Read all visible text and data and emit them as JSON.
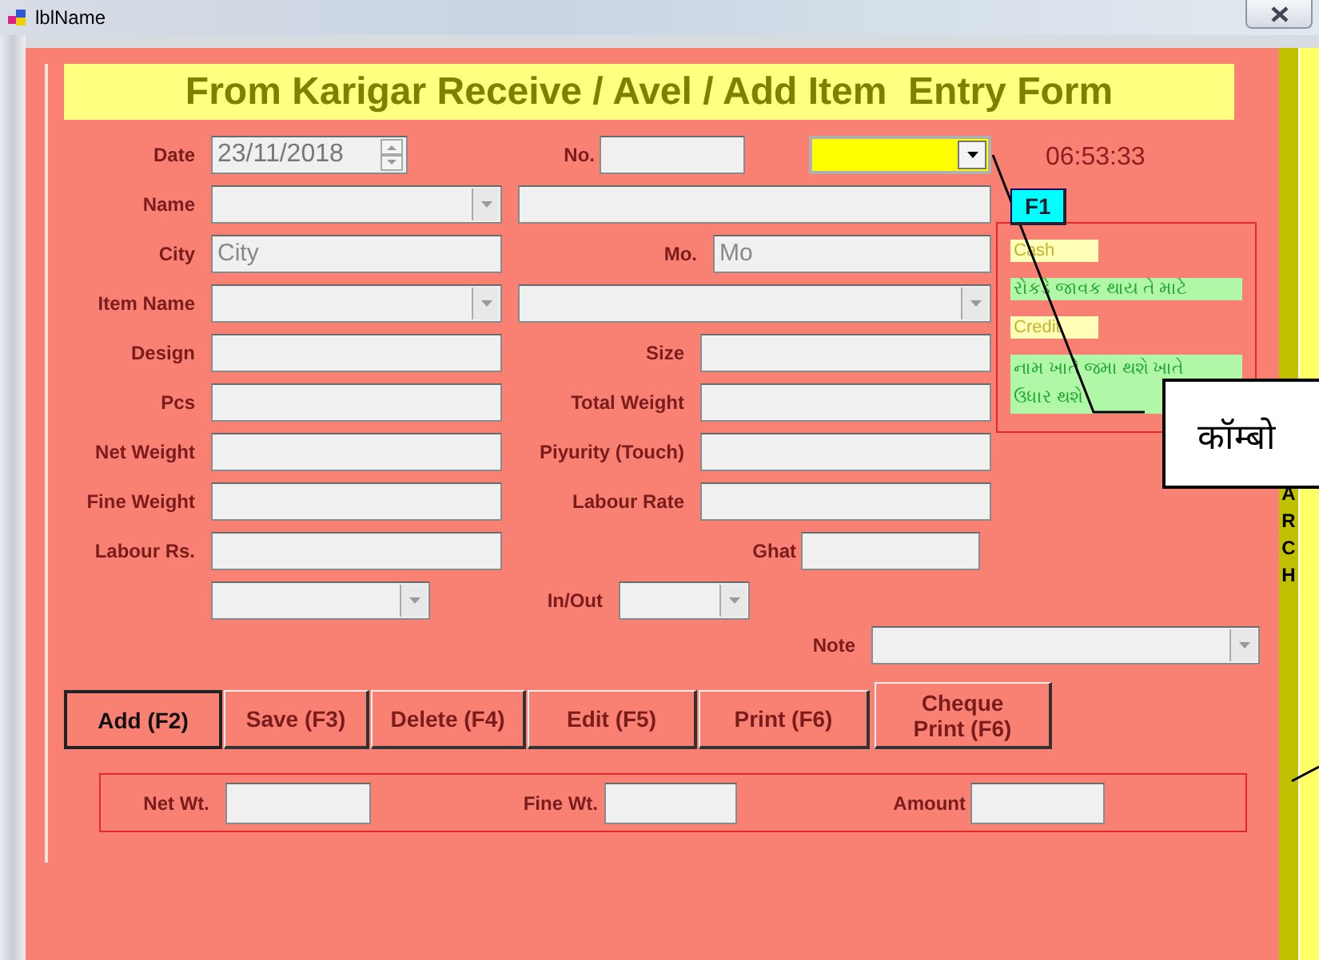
{
  "window": {
    "title": "lblName"
  },
  "form_title": "From Karigar Receive / Avel / Add Item  Entry Form",
  "rows": [
    [
      {
        "kind": "date",
        "label": "Date",
        "value": "23/11/2018"
      },
      {
        "kind": "text",
        "label": "No."
      },
      {
        "kind": "combo",
        "highlighted": true
      }
    ],
    [
      {
        "kind": "combo",
        "label": "Name",
        "highlighted": false
      },
      {
        "kind": "text"
      }
    ],
    [
      {
        "kind": "text",
        "label": "City",
        "placeholder": "City"
      },
      {
        "kind": "text",
        "label": "Mo.",
        "placeholder": "Mo"
      }
    ],
    [
      {
        "kind": "combo",
        "label": "Item Name",
        "highlighted": false
      },
      {
        "kind": "combo",
        "highlighted": false
      }
    ],
    [
      {
        "kind": "text",
        "label": "Design"
      },
      {
        "kind": "text",
        "label": "Size"
      }
    ],
    [
      {
        "kind": "text",
        "label": "Pcs"
      },
      {
        "kind": "text",
        "label": "Total Weight"
      }
    ],
    [
      {
        "kind": "text",
        "label": "Net Weight"
      },
      {
        "kind": "text",
        "label": "Piyurity (Touch)"
      }
    ],
    [
      {
        "kind": "text",
        "label": "Fine Weight"
      },
      {
        "kind": "text",
        "label": "Labour Rate"
      }
    ],
    [
      {
        "kind": "text",
        "label": "Labour  Rs."
      },
      {
        "kind": "text",
        "label": "Ghat"
      }
    ],
    [
      {
        "kind": "combo",
        "highlighted": false
      },
      {
        "kind": "combo",
        "label": "In/Out",
        "highlighted": false
      }
    ]
  ],
  "note": {
    "kind": "combo",
    "label": "Note",
    "highlighted": false
  },
  "time": "06:53:33",
  "panel": {
    "button": "F1",
    "items": [
      {
        "kind": "tag",
        "text": "Cash"
      },
      {
        "kind": "note",
        "text": "રોકડે જાવક થાય તે માટે"
      },
      {
        "kind": "tag",
        "text": "Credit"
      },
      {
        "kind": "note",
        "text": "નામ ખાતે જમા થશે ખાતે  ઉધાર થશે"
      }
    ]
  },
  "callout": "कॉम्बो",
  "side_label": "ARCH",
  "buttons": [
    {
      "label": "Add (F2)",
      "default": true
    },
    {
      "label": "Save (F3)",
      "default": false
    },
    {
      "label": "Delete (F4)",
      "default": false
    },
    {
      "label": "Edit (F5)",
      "default": false
    },
    {
      "label": "Print (F6)",
      "default": false
    },
    {
      "label": "Cheque Print (F6)",
      "default": false
    }
  ],
  "totals": [
    {
      "label": "Net Wt."
    },
    {
      "label": "Fine Wt."
    },
    {
      "label": "Amount"
    }
  ]
}
